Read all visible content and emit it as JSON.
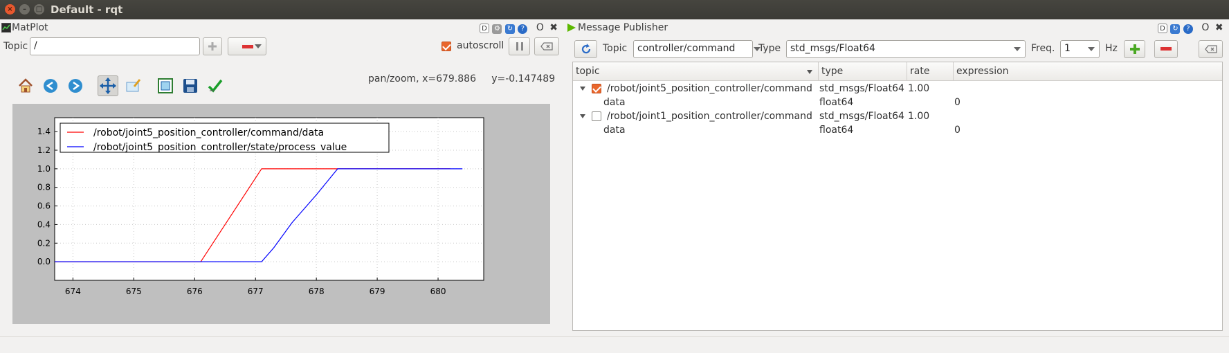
{
  "window": {
    "title": "Default - rqt"
  },
  "matplot": {
    "dock_title": "MatPlot",
    "dock_controls": [
      "D",
      "O",
      "✖"
    ],
    "topic_label": "Topic",
    "topic_value": "/",
    "autoscroll_label": "autoscroll",
    "autoscroll_checked": true,
    "status_text": "pan/zoom, x=679.886     y=-0.147489"
  },
  "publisher": {
    "dock_title": "Message Publisher",
    "dock_controls": [
      "D",
      "O",
      "✖"
    ],
    "topic_label": "Topic",
    "topic_value": "controller/command",
    "type_label": "Type",
    "type_value": "std_msgs/Float64",
    "freq_label": "Freq.",
    "freq_value": "1",
    "hz_label": "Hz",
    "columns": [
      "topic",
      "type",
      "rate",
      "expression"
    ],
    "rows": [
      {
        "topic": "/robot/joint5_position_controller/command",
        "type": "std_msgs/Float64",
        "rate": "1.00",
        "expression": "",
        "checked": true,
        "child": {
          "name": "data",
          "type": "float64",
          "expression": "0"
        }
      },
      {
        "topic": "/robot/joint1_position_controller/command",
        "type": "std_msgs/Float64",
        "rate": "1.00",
        "expression": "",
        "checked": false,
        "child": {
          "name": "data",
          "type": "float64",
          "expression": "0"
        }
      }
    ]
  },
  "chart_data": {
    "type": "line",
    "title": "",
    "xlabel": "",
    "ylabel": "",
    "xlim": [
      673.7,
      680.75
    ],
    "ylim": [
      -0.2,
      1.55
    ],
    "x_ticks": [
      "674",
      "675",
      "676",
      "677",
      "678",
      "679",
      "680"
    ],
    "y_ticks": [
      "0.0",
      "0.2",
      "0.4",
      "0.6",
      "0.8",
      "1.0",
      "1.2",
      "1.4"
    ],
    "grid": true,
    "legend_position": "top-left",
    "series": [
      {
        "name": "/robot/joint5_position_controller/command/data",
        "color": "#ff0000",
        "x": [
          673.7,
          676.1,
          677.1,
          680.2
        ],
        "y": [
          0.0,
          0.0,
          1.0,
          1.0
        ]
      },
      {
        "name": "/robot/joint5_position_controller/state/process_value",
        "color": "#0000ff",
        "x": [
          673.7,
          677.1,
          677.3,
          677.6,
          678.0,
          678.35,
          679.5,
          680.4
        ],
        "y": [
          0.0,
          0.0,
          0.15,
          0.42,
          0.72,
          1.0,
          1.0,
          1.0
        ]
      }
    ]
  }
}
